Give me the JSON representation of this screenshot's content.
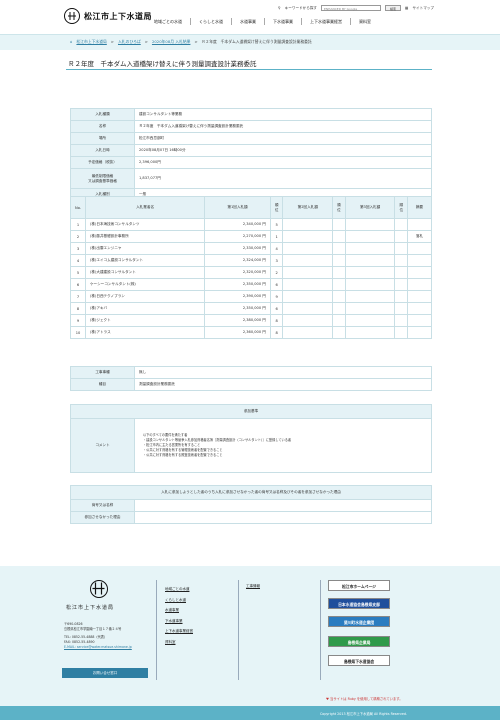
{
  "header": {
    "site_name": "松江市上下水道局",
    "keyword_label": "キーワードから探す",
    "search_placeholder": "ENHANCED BY Google",
    "search_button": "検索",
    "sitemap_label": "サイトマップ",
    "nav": [
      "地域ごとの水道",
      "くらしと水道",
      "水道事業",
      "下水道事業",
      "上下水道事業経営",
      "資料室"
    ]
  },
  "breadcrumb": [
    "松江市上下水道局",
    "入札のひろば",
    "2020年08月 入札結果",
    "Ｒ２年度　千本ダム入道橋架け替えに伴う測量調査設計業務委託"
  ],
  "page_title": "Ｒ２年度　千本ダム入道橋架け替えに伴う測量調査設計業務委託",
  "info": [
    {
      "label": "入札種類",
      "value": "建設コンサルタント等業務"
    },
    {
      "label": "名称",
      "value": "Ｒ２年度　千本ダム入道橋架け替えに伴う測量調査設計業務委託"
    },
    {
      "label": "場所",
      "value": "松江市西忌部町"
    },
    {
      "label": "入札日時",
      "value": "2020年08月07日 16時00分"
    },
    {
      "label": "予定価格（税抜）",
      "value": "2,396,000円"
    },
    {
      "label": "最低制限価格\n又は調査基準価格",
      "value": "1,837,077円"
    },
    {
      "label": "入札種別",
      "value": "一般"
    }
  ],
  "bids_header": {
    "no": "No.",
    "name": "入札業者名",
    "r1": "第1回入札額",
    "rank": "順位",
    "r2": "第2回入札額",
    "r3": "第3回入札額",
    "note": "摘要"
  },
  "bids": [
    {
      "no": "1",
      "name": "(株)日本海技術コンサルタンツ",
      "amount": "2,340,000 円",
      "rank": "5",
      "note": ""
    },
    {
      "no": "2",
      "name": "(株)藤井基礎設計事務所",
      "amount": "2,270,000 円",
      "rank": "1",
      "note": "落札"
    },
    {
      "no": "3",
      "name": "(株)出雲エンジニヤ",
      "amount": "2,330,000 円",
      "rank": "4",
      "note": ""
    },
    {
      "no": "4",
      "name": "(株)エイコム建設コンサルタント",
      "amount": "2,324,000 円",
      "rank": "3",
      "note": ""
    },
    {
      "no": "5",
      "name": "(株)大建建設コンサルタント",
      "amount": "2,320,000 円",
      "rank": "2",
      "note": ""
    },
    {
      "no": "6",
      "name": "ケーシーコンサルタント(株)",
      "amount": "2,350,000 円",
      "rank": "6",
      "note": ""
    },
    {
      "no": "7",
      "name": "(株)日西テクノプラン",
      "amount": "2,390,000 円",
      "rank": "9",
      "note": ""
    },
    {
      "no": "8",
      "name": "(株)アキバ",
      "amount": "2,350,000 円",
      "rank": "6",
      "note": ""
    },
    {
      "no": "9",
      "name": "(株)ジェクト",
      "amount": "2,380,000 円",
      "rank": "8",
      "note": ""
    },
    {
      "no": "10",
      "name": "(株)アトラス",
      "amount": "2,360,000 円",
      "rank": "8",
      "note": ""
    }
  ],
  "work": [
    {
      "label": "工事事種",
      "value": "無し"
    },
    {
      "label": "種目",
      "value": "測量調査設計業務委託"
    }
  ],
  "criteria": {
    "heading": "参加基準",
    "label": "コメント",
    "lines": [
      "以下のすべての要件を満たす者",
      "・建設コンサルタント等競争入札参加資格者名簿［測量調査設計（コンサルタント）］に登録している者",
      "・松江市内に主たる営業所を有すること",
      "・公共に対す資格を有する管理技術者を配置できること",
      "・公共に対す資格を有する照査技術者を配置できること"
    ]
  },
  "withdrawn": {
    "heading": "入札に参加しようとした者のうち入札に参加させなかった者の商号又は名称及びその者を参加させなかった理由",
    "rows": [
      {
        "label": "商号又は名称",
        "value": ""
      },
      {
        "label": "参加させなかった理由",
        "value": ""
      }
    ]
  },
  "footer": {
    "org": "松江市上下水道局",
    "address": [
      "〒690-0826",
      "島根県松江市学園南一丁目１７番２４号",
      "",
      "TEL: 0852-55-4888（代表）",
      "FAX: 0852-55-4890",
      "E-MAIL: service@water.matsue.shimane.jp"
    ],
    "contact_button": "お問い合せ窓口",
    "links": [
      "地域ごとの水道",
      "くらしと水道",
      "水道事業",
      "下水道事業",
      "上下水道事業経営",
      "資料室"
    ],
    "links2": "工事情報",
    "banners": [
      {
        "label": "松江市ホームページ",
        "bg": "#ffffff",
        "fg": "#222222"
      },
      {
        "label": "日本水道協会島根県支部",
        "bg": "#1f4f9c",
        "fg": "#ffffff"
      },
      {
        "label": "斐川町水道企業団",
        "bg": "#2a7cc0",
        "fg": "#ffffff"
      },
      {
        "label": "島根県企業局",
        "bg": "#2f9a4a",
        "fg": "#ffffff"
      },
      {
        "label": "島根県下水道協会",
        "bg": "#ffffff",
        "fg": "#222222"
      }
    ],
    "twitter": "当サイトは Ruby を使用して構築されています。",
    "copyright": "Copyright 2013 松江市上下水道局 All Rights Reserved."
  }
}
